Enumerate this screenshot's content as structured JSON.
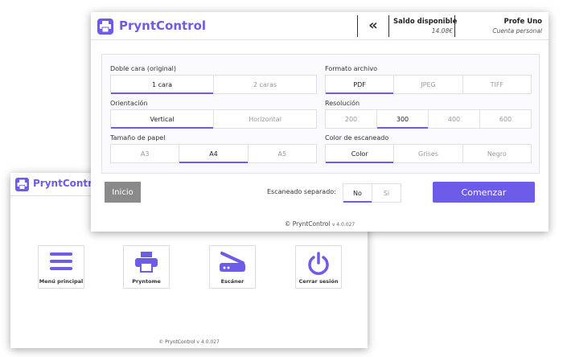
{
  "colors": {
    "accent": "#6c5ce7",
    "inicio_bg": "#8a8a8a"
  },
  "home": {
    "brand": "PryntControl",
    "tiles": [
      {
        "label": "Menú principal",
        "icon": "menu-icon"
      },
      {
        "label": "Pryntome",
        "icon": "printer-icon"
      },
      {
        "label": "Escáner",
        "icon": "scanner-icon"
      },
      {
        "label": "Cerrar sesión",
        "icon": "power-icon"
      }
    ],
    "footer": "© PryntControl",
    "version": "v 4.0.027"
  },
  "scan": {
    "brand": "PryntControl",
    "header": {
      "balance_label": "Saldo disponible",
      "balance_value": "14.08€",
      "user_name": "Profe Uno",
      "user_role": "Cuenta personal"
    },
    "doble_cara": {
      "label": "Doble cara (original)",
      "options": [
        "1 cara",
        "2 caras"
      ],
      "selected": 0
    },
    "orientacion": {
      "label": "Orientación",
      "options": [
        "Vertical",
        "Horizontal"
      ],
      "selected": 0
    },
    "tamano": {
      "label": "Tamaño de papel",
      "options": [
        "A3",
        "A4",
        "A5"
      ],
      "selected": 1
    },
    "formato": {
      "label": "Formato archivo",
      "options": [
        "PDF",
        "JPEG",
        "TIFF"
      ],
      "selected": 0
    },
    "resolucion": {
      "label": "Resolución",
      "options": [
        "200",
        "300",
        "400",
        "600"
      ],
      "selected": 1
    },
    "color": {
      "label": "Color de escaneado",
      "options": [
        "Color",
        "Grises",
        "Negro"
      ],
      "selected": 0
    },
    "inicio_label": "Inicio",
    "separado": {
      "label": "Escaneado separado:",
      "options": [
        "No",
        "Sí"
      ],
      "selected": 0
    },
    "start_label": "Comenzar",
    "footer": "© PryntControl",
    "version": "v 4.0.027"
  }
}
